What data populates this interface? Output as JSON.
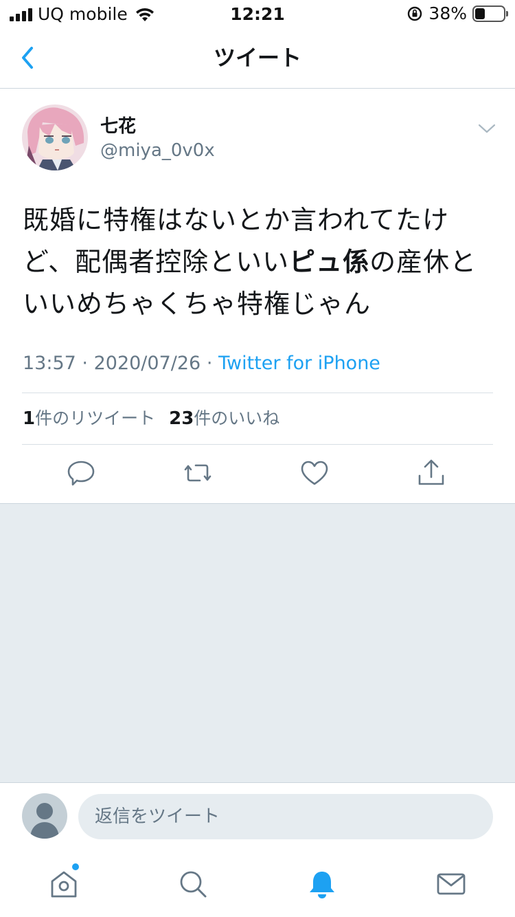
{
  "status_bar": {
    "carrier": "UQ mobile",
    "time": "12:21",
    "battery_percent": "38%",
    "battery_level": 0.38
  },
  "header": {
    "title": "ツイート"
  },
  "tweet": {
    "display_name": "七花",
    "handle": "@miya_0v0x",
    "text_line1": "既婚に特権はないとか言われてたけ",
    "text_line2_a": "ど、配偶者控除といい",
    "text_line2_bold": "ピュ係",
    "text_line2_b": "の産休と",
    "text_line3": "いいめちゃくちゃ特権じゃん",
    "time": "13:57",
    "date": "2020/07/26",
    "separator": "·",
    "source": "Twitter for iPhone",
    "retweet_count": "1",
    "retweet_label": "件のリツイート",
    "like_count": "23",
    "like_label": "件のいいね"
  },
  "reply": {
    "placeholder": "返信をツイート"
  },
  "colors": {
    "accent": "#1da1f2",
    "secondary_text": "#657786",
    "background_gray": "#e6ecf0"
  },
  "icons": [
    "back-icon",
    "caret-down-icon",
    "reply-icon",
    "retweet-icon",
    "like-icon",
    "share-icon",
    "home-icon",
    "search-icon",
    "notifications-icon",
    "messages-icon"
  ]
}
